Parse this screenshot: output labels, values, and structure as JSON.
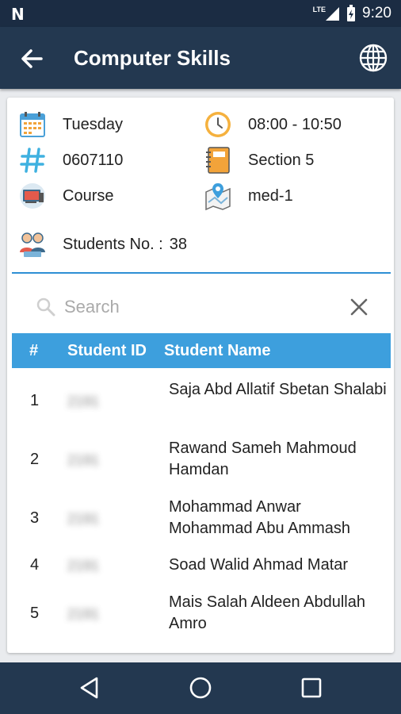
{
  "status_bar": {
    "left_icon": "N",
    "network": "LTE",
    "time": "9:20"
  },
  "app_bar": {
    "title": "Computer Skills",
    "back_icon": "arrow-left-icon",
    "globe_icon": "globe-icon"
  },
  "info": {
    "day": "Tuesday",
    "time": "08:00 - 10:50",
    "code": "0607110",
    "section": "Section 5",
    "type": "Course",
    "location": "med-1",
    "students_label": "Students No. :",
    "students_count": "38"
  },
  "search": {
    "placeholder": "Search"
  },
  "table": {
    "headers": {
      "num": "#",
      "id": "Student ID",
      "name": "Student Name"
    },
    "rows": [
      {
        "num": "1",
        "id": "2191",
        "name": "Saja Abd Allatif Sbetan Shalabi"
      },
      {
        "num": "2",
        "id": "2191",
        "name": "Rawand  Sameh Mahmoud Hamdan"
      },
      {
        "num": "3",
        "id": "2191",
        "name": "Mohammad Anwar Mohammad Abu Ammash"
      },
      {
        "num": "4",
        "id": "2191",
        "name": "Soad Walid Ahmad Matar"
      },
      {
        "num": "5",
        "id": "2191",
        "name": "Mais Salah Aldeen Abdullah Amro"
      }
    ]
  },
  "colors": {
    "app_bar": "#233850",
    "status_bar": "#1b2c43",
    "accent": "#3d9fdd",
    "divider": "#2e8fd4"
  }
}
